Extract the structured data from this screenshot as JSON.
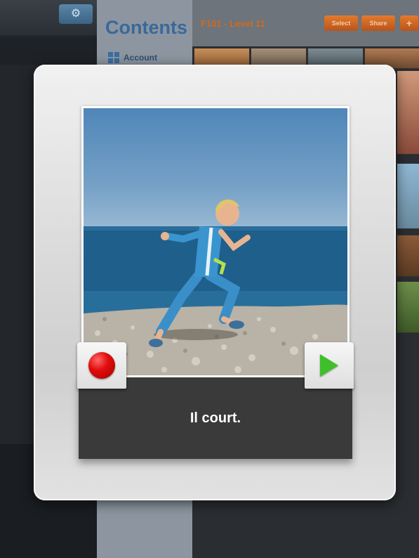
{
  "background": {
    "sidebar": {
      "title": "Contents",
      "items": [
        {
          "label": "Account",
          "icon": "grid-icon"
        }
      ]
    },
    "header": {
      "course_title": "F101 - Level 11",
      "buttons": [
        {
          "label": "Select"
        },
        {
          "label": "Share"
        },
        {
          "label": "+"
        }
      ]
    }
  },
  "card": {
    "caption": "Il court.",
    "photo_description": "boy-running-on-pebble-beach",
    "record_button_icon": "record-icon",
    "play_button_icon": "play-icon",
    "colors": {
      "caption_bg": "#3a3a3a",
      "record": "#e20d0d",
      "play": "#3fbf2a"
    }
  }
}
